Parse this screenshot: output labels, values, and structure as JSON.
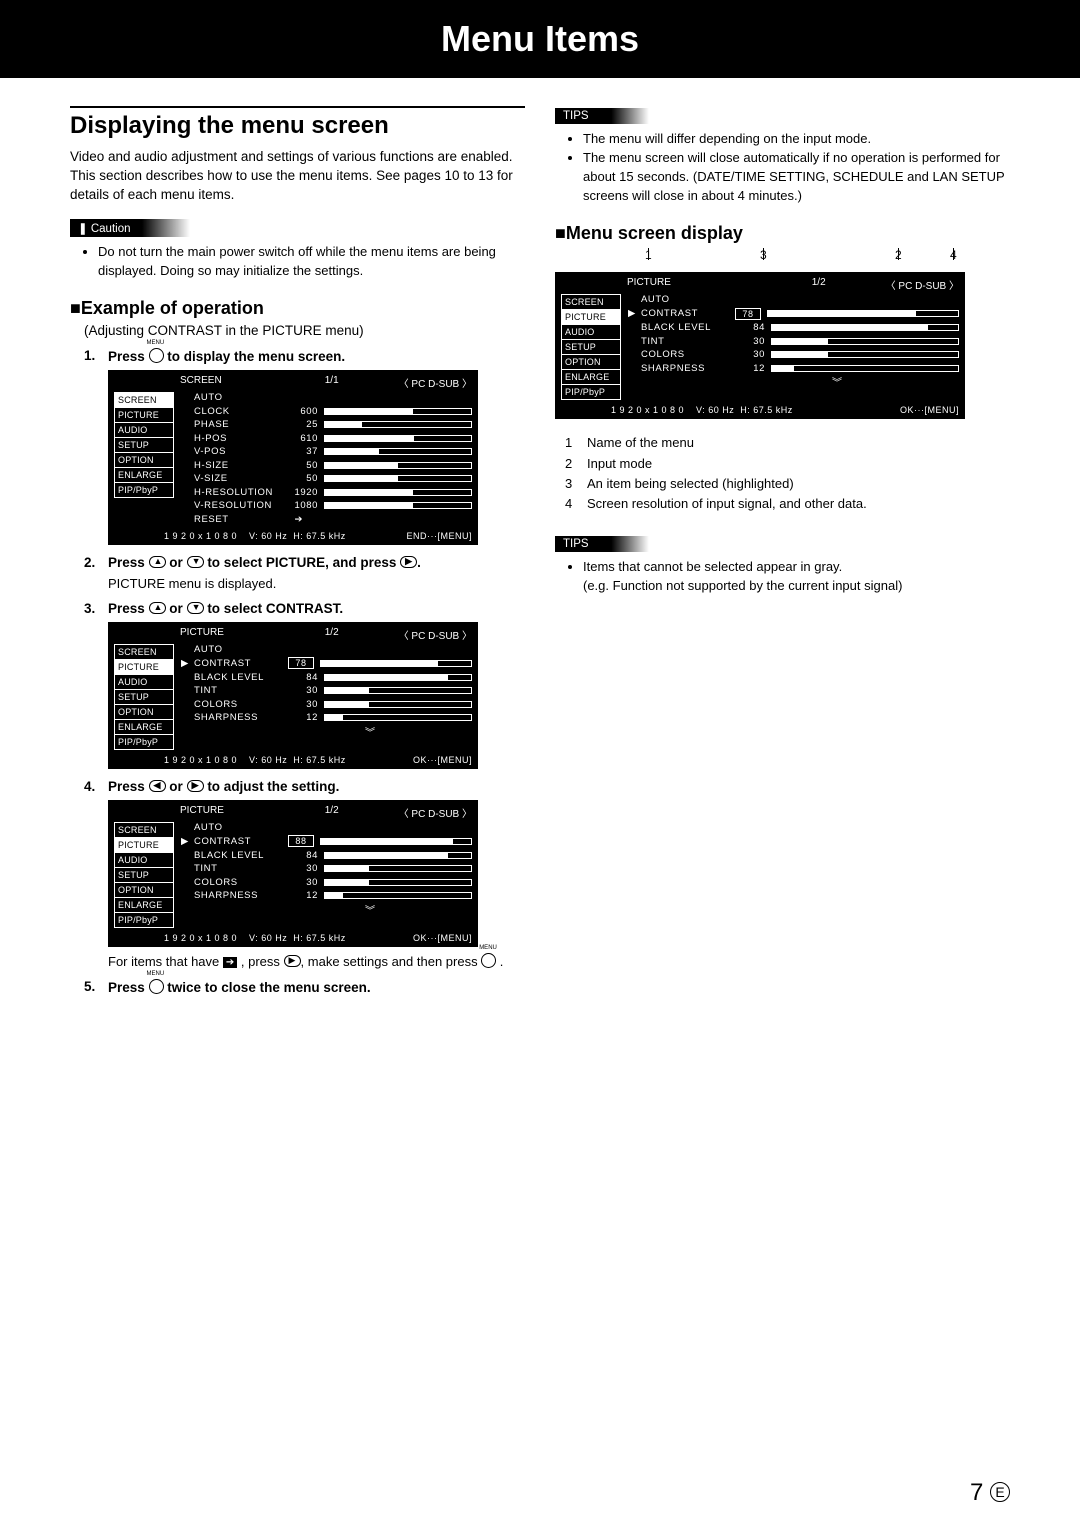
{
  "title": "Menu Items",
  "h2": "Displaying the menu screen",
  "intro": "Video and audio adjustment and settings of various functions are enabled. This section describes how to use the menu items. See pages 10 to 13 for details of each menu items.",
  "caution_label": "Caution",
  "caution_text": "Do not turn the main power switch off while the menu items are being displayed. Doing so may initialize the settings.",
  "example_heading": "Example of operation",
  "example_sub": "(Adjusting CONTRAST in the PICTURE menu)",
  "steps": {
    "s1a": "Press ",
    "s1b": " to display the menu screen.",
    "s2a": "Press ",
    "s2b": " or ",
    "s2c": " to select PICTURE, and press ",
    "s2d": ".",
    "s2_plain": "PICTURE menu is displayed.",
    "s3a": "Press ",
    "s3b": " or ",
    "s3c": " to select CONTRAST.",
    "s4a": "Press ",
    "s4b": " or ",
    "s4c": " to adjust the setting.",
    "s4_plain_a": "For items that have ",
    "s4_plain_b": " , press ",
    "s4_plain_c": ", make settings and then press ",
    "s4_plain_d": " .",
    "s5a": "Press ",
    "s5b": " twice to close the menu screen."
  },
  "tips_label": "TIPS",
  "tips1": [
    "The menu will differ depending on the input mode.",
    "The menu screen will close automatically if no operation is performed for about 15 seconds. (DATE/TIME SETTING, SCHEDULE and LAN SETUP screens will close in about 4 minutes.)"
  ],
  "menu_screen_heading": "Menu screen display",
  "legend": [
    "Name of the menu",
    "Input mode",
    "An item being selected (highlighted)",
    "Screen resolution of input signal, and other data."
  ],
  "tips2": [
    "Items that cannot be selected appear in gray.\n(e.g. Function not supported by the current input signal)"
  ],
  "osd": {
    "tabs": [
      "SCREEN",
      "PICTURE",
      "AUDIO",
      "SETUP",
      "OPTION",
      "ENLARGE",
      "PIP/PbyP"
    ],
    "input": "〈 PC D-SUB 〉",
    "foot_res": "1 9 2 0 x 1 0 8 0",
    "foot_v": "V: 60 Hz",
    "foot_h": "H: 67.5 kHz",
    "end": "END···[MENU]",
    "ok": "OK···[MENU]",
    "screen": {
      "title": "SCREEN",
      "page": "1/1",
      "rows": [
        {
          "nm": "AUTO"
        },
        {
          "nm": "CLOCK",
          "v": 600,
          "max": 1000
        },
        {
          "nm": "PHASE",
          "v": 25,
          "max": 100
        },
        {
          "nm": "H-POS",
          "v": 610,
          "max": 1000
        },
        {
          "nm": "V-POS",
          "v": 37,
          "max": 100
        },
        {
          "nm": "H-SIZE",
          "v": 50,
          "max": 100
        },
        {
          "nm": "V-SIZE",
          "v": 50,
          "max": 100
        },
        {
          "nm": "H-RESOLUTION",
          "v": 1920,
          "nobar": true
        },
        {
          "nm": "V-RESOLUTION",
          "v": 1080,
          "nobar": true
        },
        {
          "nm": "RESET",
          "arrow": true
        }
      ]
    },
    "picture": {
      "title": "PICTURE",
      "page": "1/2",
      "rows": [
        {
          "nm": "AUTO"
        },
        {
          "nm": "CONTRAST",
          "v": 78,
          "max": 100,
          "sel": true,
          "box": true
        },
        {
          "nm": "BLACK LEVEL",
          "v": 84,
          "max": 100
        },
        {
          "nm": "TINT",
          "v": 30,
          "max": 100
        },
        {
          "nm": "COLORS",
          "v": 30,
          "max": 100
        },
        {
          "nm": "SHARPNESS",
          "v": 12,
          "max": 100
        }
      ]
    },
    "picture2": {
      "title": "PICTURE",
      "page": "1/2",
      "rows": [
        {
          "nm": "AUTO"
        },
        {
          "nm": "CONTRAST",
          "v": 88,
          "max": 100,
          "sel": true,
          "box": true
        },
        {
          "nm": "BLACK LEVEL",
          "v": 84,
          "max": 100
        },
        {
          "nm": "TINT",
          "v": 30,
          "max": 100
        },
        {
          "nm": "COLORS",
          "v": 30,
          "max": 100
        },
        {
          "nm": "SHARPNESS",
          "v": 12,
          "max": 100
        }
      ]
    }
  },
  "callouts": [
    "1",
    "3",
    "2",
    "4"
  ],
  "page_num": "7",
  "page_e": "E"
}
